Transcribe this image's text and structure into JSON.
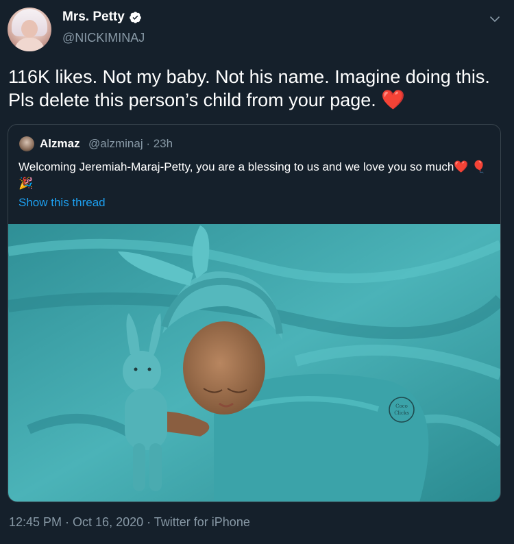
{
  "author": {
    "display_name": "Mrs. Petty",
    "handle": "@NICKIMINAJ",
    "verified": true
  },
  "tweet": {
    "text": "116K likes. Not my baby. Not his name. Imagine doing this. Pls delete this person’s child from your page.",
    "emoji": "❤️"
  },
  "quoted_tweet": {
    "display_name": "Alzmaz",
    "handle": "@alzminaj · 23h",
    "text": "Welcoming Jeremiah-Maraj-Petty, you are a blessing to us and we love you so much",
    "emojis": "❤️ 🎈🎉",
    "show_thread": "Show this thread",
    "photo_watermark": "Coco Clicks"
  },
  "meta": {
    "timestamp": "12:45 PM · Oct 16, 2020 · Twitter for iPhone"
  },
  "colors": {
    "background": "#15202b",
    "link": "#1da1f2",
    "secondary": "#8899a6",
    "border": "#38444d",
    "photo_teal": "#3fa6ad"
  }
}
